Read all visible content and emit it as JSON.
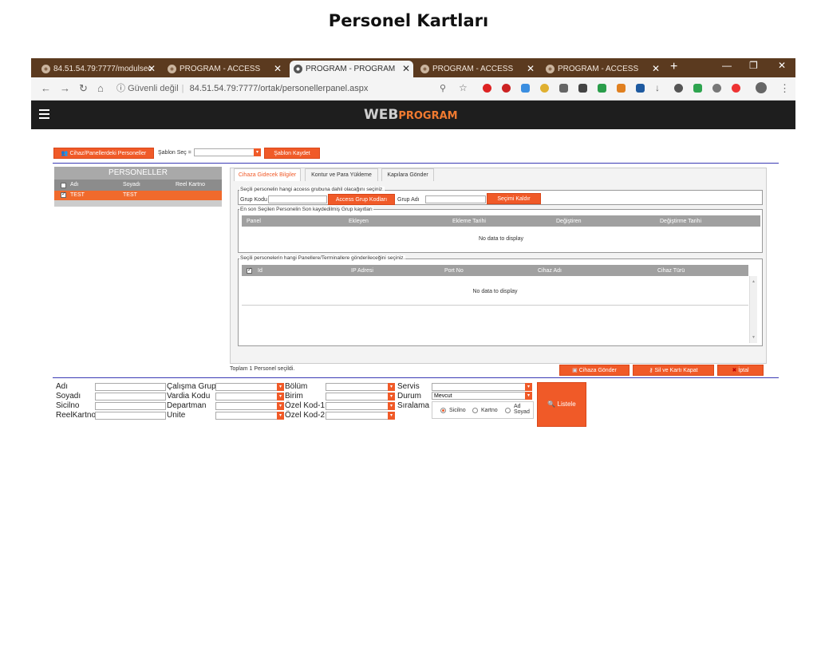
{
  "page_title": "Personel Kartları",
  "browser": {
    "tabs": [
      {
        "label": "84.51.54.79:7777/modulsec",
        "active": false
      },
      {
        "label": "PROGRAM - ACCESS",
        "active": false
      },
      {
        "label": "PROGRAM - PROGRAM",
        "active": true
      },
      {
        "label": "PROGRAM - ACCESS",
        "active": false
      },
      {
        "label": "PROGRAM - ACCESS",
        "active": false
      }
    ],
    "new_tab": "+",
    "security_label": "Güvenli değil",
    "url": "84.51.54.79:7777/ortak/personellerpanel.aspx"
  },
  "app": {
    "logo_web": "WEB",
    "logo_program": "PROGRAM"
  },
  "toolbar": {
    "device_personnel_button": "Cihaz/Panellerdeki Personeller",
    "template_label": "Şablon Seç =",
    "template_value": "",
    "save_template_button": "Şablon Kaydet"
  },
  "personnel": {
    "title": "PERSONELLER",
    "columns": [
      "Adı",
      "Soyadı",
      "Reel Kartno"
    ],
    "rows": [
      {
        "ad": "TEST",
        "soyad": "TEST",
        "reel_kartno": "",
        "checked": true
      }
    ]
  },
  "tabs": [
    "Cihaza Gidecek Bilgiler",
    "Kontur ve Para Yükleme",
    "Kapılara Gönder"
  ],
  "group_section": {
    "legend": "Seçili personelin hangi access grubuna dahil olacağını seçiniz.",
    "group_code_label": "Grup Kodu",
    "group_code_value": "",
    "access_group_codes_button": "Access Grup Kodları",
    "group_name_label": "Grup Adı",
    "group_name_value": "",
    "remove_selection_button": "Seçimi Kaldır"
  },
  "last_groups": {
    "legend": "En son Seçilen Personelin Son kaydedilmiş Grup kayıtları",
    "columns": [
      "Panel",
      "Ekleyen",
      "Ekleme Tarihi",
      "Değiştiren",
      "Değiştirme Tarihi"
    ],
    "empty_text": "No data to display"
  },
  "panels_section": {
    "legend": "Seçili personelerin hangi Panellere/Terminallere gönderileceğini seçiniz.",
    "columns": [
      "Id",
      "IP Adresi",
      "Port No",
      "Cihaz Adı",
      "Cihaz Türü"
    ],
    "empty_text": "No data to display"
  },
  "summary": "Toplam 1 Personel seçildi.",
  "actions": {
    "send_device": "Cihaza Gönder",
    "delete_close_card": "Sil ve Kartı Kapat",
    "cancel": "İptal"
  },
  "filters": {
    "ad": "Adı",
    "soyad": "Soyadı",
    "sicilno": "Sicilno",
    "reelkartno": "ReelKartno",
    "calisma_grup": "Çalışma Grup",
    "vardiya_kodu": "Vardia Kodu",
    "departman": "Departman",
    "unite": "Unite",
    "bolum": "Bölüm",
    "birim": "Birim",
    "ozel_kod_1": "Özel Kod-1",
    "ozel_kod_2": "Özel Kod-2",
    "servis": "Servis",
    "durum": "Durum",
    "durum_value": "Mevcut",
    "siralama": "Sıralama",
    "sort_options": [
      "Sicilno",
      "Kartno",
      "Ad Soyad"
    ],
    "list_button": "Listele"
  },
  "colors": {
    "accent": "#f05a28",
    "tabbar": "#5b3a1f",
    "appbar": "#1e1e1e"
  }
}
